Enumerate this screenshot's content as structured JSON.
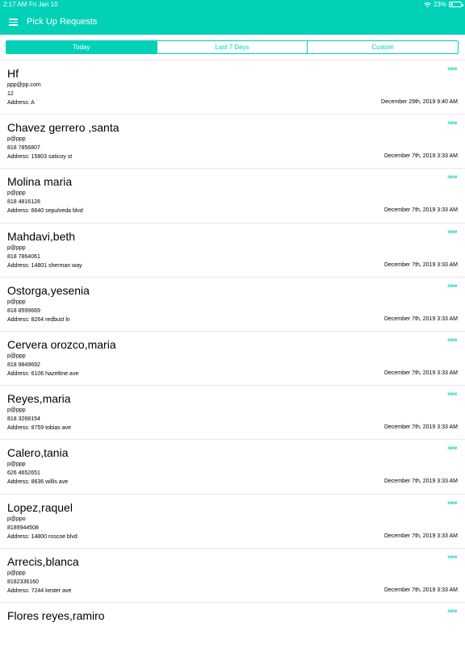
{
  "status_bar": {
    "time": "2:17 AM",
    "date": "Fri Jan 10",
    "battery": "23%",
    "battery_level": 0.23,
    "wifi_icon": "wifi-icon"
  },
  "nav": {
    "title": "Pick Up Requests",
    "menu_icon": "hamburger-menu-icon"
  },
  "tabs": [
    {
      "label": "Today",
      "active": true
    },
    {
      "label": "Last 7 Days",
      "active": false
    },
    {
      "label": "Custom",
      "active": false
    }
  ],
  "colors": {
    "accent": "#00d1b7"
  },
  "requests": [
    {
      "name": "Hf",
      "email": "ppp@pp.com",
      "phone": "12",
      "address": "Address: A",
      "date": "December 29th, 2019 9:40 AM",
      "status": "new"
    },
    {
      "name": "Chavez gerrero ,santa",
      "email": "p@ppp",
      "phone": "818 7856807",
      "address": "Address: 15803 saticoy st",
      "date": "December 7th, 2019 3:33 AM",
      "status": "new"
    },
    {
      "name": "Molina maria",
      "email": "p@ppp",
      "phone": "818 4816128",
      "address": "Address: 6640 sepulveda blvd",
      "date": "December 7th, 2019 3:33 AM",
      "status": "new"
    },
    {
      "name": "Mahdavi,beth",
      "email": "p@ppp",
      "phone": "818 7864061",
      "address": "Address: 14801 sherman way",
      "date": "December 7th, 2019 3:33 AM",
      "status": "new"
    },
    {
      "name": "Ostorga,yesenia",
      "email": "p@ppp",
      "phone": "818 8599669",
      "address": "Address: 8264 redbust ln",
      "date": "December 7th, 2019 3:33 AM",
      "status": "new"
    },
    {
      "name": "Cervera orozco,maria",
      "email": "p@ppp",
      "phone": "818 9849692",
      "address": "Address: 6106 hazeltine ave",
      "date": "December 7th, 2019 3:33 AM",
      "status": "new"
    },
    {
      "name": "Reyes,maria",
      "email": "p@ppp",
      "phone": "818 3268154",
      "address": "Address: 8759 tobias ave",
      "date": "December 7th, 2019 3:33 AM",
      "status": "new"
    },
    {
      "name": "Calero,tania",
      "email": "p@ppp",
      "phone": "626 4652651",
      "address": "Address: 8636 willis ave",
      "date": "December 7th, 2019 3:33 AM",
      "status": "new"
    },
    {
      "name": "Lopez,raquel",
      "email": "p@ppo",
      "phone": "8189944508",
      "address": "Address: 14800 roscoe blvd",
      "date": "December 7th, 2019 3:33 AM",
      "status": "new"
    },
    {
      "name": "Arrecis,blanca",
      "email": "p@ppp",
      "phone": "8182336160",
      "address": "Address: 7244 kester ave",
      "date": "December 7th, 2019 3:33 AM",
      "status": "new"
    },
    {
      "name": "Flores reyes,ramiro",
      "email": "",
      "phone": "",
      "address": "",
      "date": "",
      "status": "new"
    }
  ]
}
